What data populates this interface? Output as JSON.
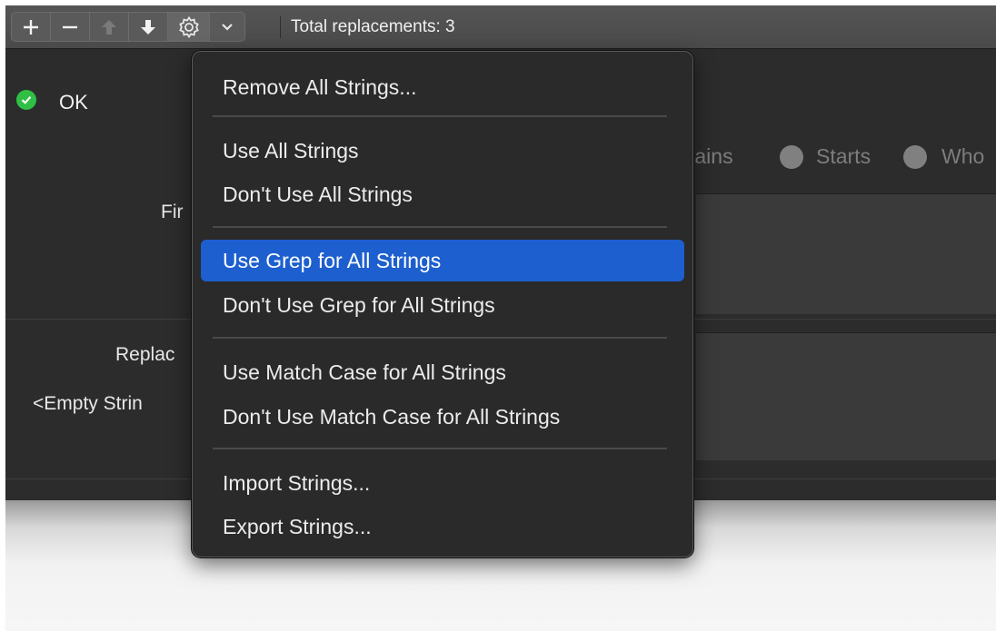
{
  "toolbar": {
    "add_icon": "plus-icon",
    "remove_icon": "minus-icon",
    "move_up_icon": "arrow-up-icon",
    "move_down_icon": "arrow-down-icon",
    "gear_icon": "gear-icon",
    "chevron_icon": "chevron-down-icon",
    "status_text": "Total replacements: 3"
  },
  "status": {
    "label": "OK",
    "icon": "check-circle-icon",
    "color": "#2fbf45"
  },
  "match_options": {
    "partial_left": "tains",
    "starts": "Starts",
    "whole_partial": "Who"
  },
  "form": {
    "find_label_partial": "Fir",
    "replace_label_partial": "Replac",
    "empty_string_partial": "<Empty Strin"
  },
  "menu": {
    "items": [
      {
        "label": "Remove All Strings..."
      },
      {
        "label": "Use All Strings"
      },
      {
        "label": "Don't Use All Strings"
      },
      {
        "label": "Use Grep for All Strings",
        "highlighted": true
      },
      {
        "label": "Don't Use Grep for All Strings"
      },
      {
        "label": "Use Match Case for All Strings"
      },
      {
        "label": "Don't Use Match Case for All Strings"
      },
      {
        "label": "Import Strings..."
      },
      {
        "label": "Export Strings..."
      }
    ],
    "highlight_color": "#1d5fcf"
  }
}
